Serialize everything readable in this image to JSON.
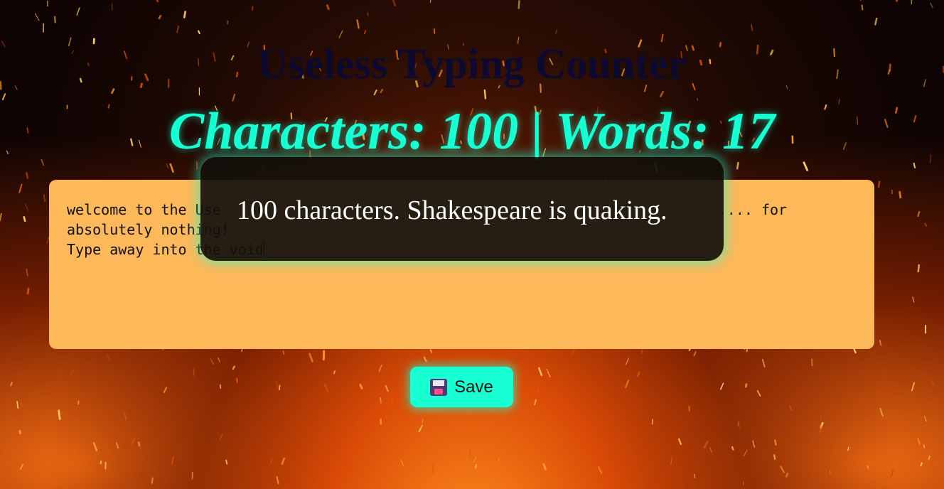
{
  "page": {
    "title": "Useless Typing Counter",
    "counter_text": "Characters: 100 | Words: 17"
  },
  "editor": {
    "value": "welcome to the Useless Typing Counter where you can type stuff.... for absolutely nothing!\nType away into the void",
    "visible_lines": [
      "welcome to the Use",
      "absolutely nothing!",
      "Type away into the void"
    ],
    "visible_tail_line1": ".... for"
  },
  "toast": {
    "message": "100 characters. Shakespeare is quaking."
  },
  "toolbar": {
    "save_label": "Save",
    "save_icon": "floppy-disk-icon"
  },
  "colors": {
    "accent": "#19ffd4",
    "title": "#0c0a2e",
    "editor_bg": "#fdb85a",
    "toast_bg": "#14100c"
  }
}
